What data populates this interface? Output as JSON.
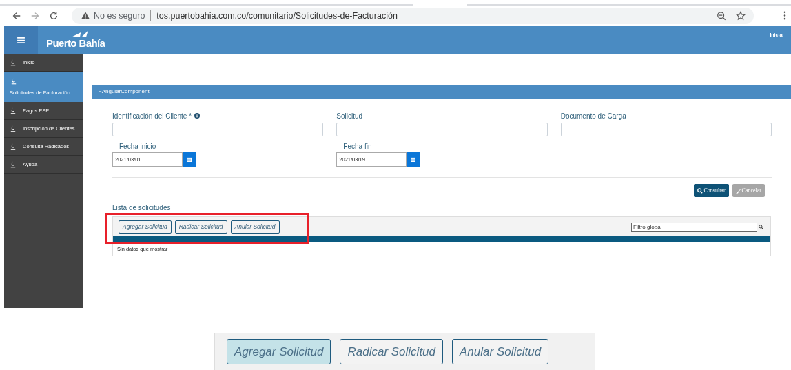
{
  "browser": {
    "security": "No es seguro",
    "url": "tos.puertobahia.com.co/comunitario/Solicitudes-de-Facturación"
  },
  "header": {
    "logo": "Puerto Bahía",
    "link": "Iniciar"
  },
  "sidebar": {
    "items": [
      {
        "label": "Inicio",
        "selected": false
      },
      {
        "label": "Solicitudes de Facturación",
        "selected": true
      },
      {
        "label": "Pagos PSE",
        "selected": false
      },
      {
        "label": "Inscripción de Clientes",
        "selected": false
      },
      {
        "label": "Consulta Radicados",
        "selected": false
      },
      {
        "label": "Ayuda",
        "selected": false
      }
    ]
  },
  "panel": {
    "title": "≡AngularComponent",
    "fields": [
      {
        "label": "Identificación del Cliente *",
        "info": true
      },
      {
        "label": "Solicitud",
        "info": false
      },
      {
        "label": "Documento de Carga",
        "info": false
      }
    ],
    "dates": [
      {
        "label": "Fecha inicio",
        "value": "2021/03/01"
      },
      {
        "label": "Fecha fin",
        "value": "2021/03/19"
      }
    ],
    "actions": [
      {
        "label": "Consultar",
        "kind": "search",
        "disabled": false
      },
      {
        "label": "Cancelar",
        "kind": "clear",
        "disabled": true
      }
    ],
    "list": {
      "title": "Lista de solicitudes",
      "buttons": [
        {
          "label": "Agregar Solicitud",
          "selected": false
        },
        {
          "label": "Radicar Solicitud",
          "selected": false
        },
        {
          "label": "Anular Solicitud",
          "selected": false
        }
      ],
      "filter": {
        "placeholder": "Filtro global"
      },
      "empty": "Sin datos que mostrar"
    }
  },
  "zoom_inset": {
    "buttons": [
      {
        "label": "Agregar Solicitud",
        "selected": true
      },
      {
        "label": "Radicar Solicitud",
        "selected": false
      },
      {
        "label": "Anular Solicitud",
        "selected": false
      }
    ]
  }
}
